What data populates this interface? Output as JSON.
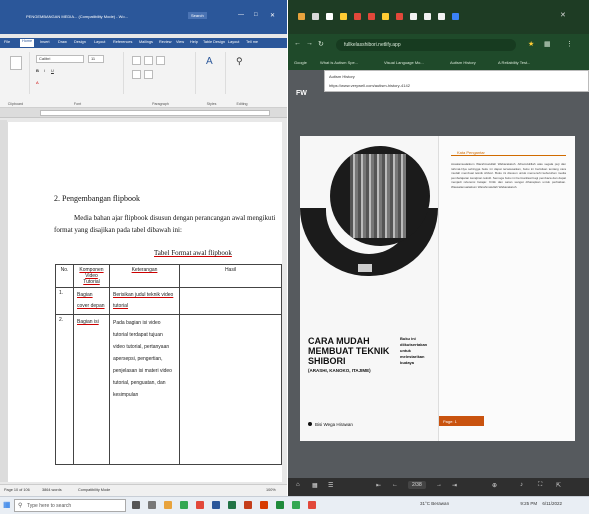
{
  "word": {
    "title": "PENGEMBANGAN MEDIA... (Compatibility Mode) - Wo...",
    "search_label": "Search",
    "menu_tabs": [
      "File",
      "Home",
      "Insert",
      "Draw",
      "Design",
      "Layout",
      "References",
      "Mailings",
      "Review",
      "View",
      "Help",
      "Table Design",
      "Layout",
      "Tell me"
    ],
    "ribbon_groups": [
      "Clipboard",
      "Font",
      "Paragraph",
      "Styles",
      "Editing"
    ],
    "font_name": "Calibri",
    "font_size": "11",
    "heading": "2. Pengembangan flipbook",
    "paragraph": "Media bahan ajar flipbook disusun dengan perancangan awal mengikuti format yang disajikan pada tabel dibawah ini:",
    "caption": "Tabel Format awal flipbook",
    "table": {
      "headers": [
        "No.",
        "Komponen Video Tutorial",
        "Keterangan",
        "Hasil"
      ],
      "rows": [
        {
          "no": "1.",
          "komponen": "Bagian cover depan",
          "keterangan": "Berisikan judul teknik video tutorial",
          "hasil": ""
        },
        {
          "no": "2.",
          "komponen": "Bagian isi",
          "keterangan": "Pada bagian isi video tutorial terdapat tujuan video tutorial, pertanyaan apersepsi, pengertian, penjelasan isi materi video tutorial, penguatan, dan kesimpulan",
          "hasil": ""
        }
      ]
    },
    "status": {
      "page": "Page 10 of 106",
      "words": "3864 words",
      "mode": "Compatibility Mode",
      "zoom": "100%"
    }
  },
  "browser": {
    "url": "fullkelasshibori.netlify.app",
    "bookmarks": [
      "Google",
      "What is Autism Spe...",
      "Visual Language Mo...",
      "Autism History",
      "A Reliability Test..."
    ],
    "history_title": "Autism History",
    "history_url": "https://www.verywell.com/autism-history-4142",
    "logo": "FW",
    "book": {
      "title": "CARA MUDAH MEMBUAT TEKNIK SHIBORI",
      "subtitle": "(ARASHI, KANOKO, ITAJIME)",
      "note": "Buku ini diikutsertakan untuk melestarikan budaya",
      "author": "Bisi Wega Hirawan",
      "kata_title": "Kata Pengantar",
      "kata_text": "Assalamualaikum Warahmatullah Wabarakatuh. Alhamdulillah atas segala puji dan rahmat-Nya sehingga buku ini dapat terselesaikan, buku ini berisikan tentang cara mudah membuat teknik shibori. Buku ini disusun untuk memenuhi kebutuhan media pembelajaran kerajinan tekstil. Semoga buku ini bermanfaat bagi pembaca dan dapat menjadi referensi belajar. Kritik dan saran sangat diharapkan untuk perbaikan. Wassalamualaikum Warahmatullah Wabarakatuh.",
      "page_label": "Page: 1"
    },
    "page_indicator": "2/38"
  },
  "taskbar": {
    "search_placeholder": "Type here to search",
    "weather": "31°C Berawan",
    "time": "9:25 PM",
    "date": "6/11/2022"
  },
  "colors": {
    "word_blue": "#2b579a",
    "browser_green": "#1f4a2a",
    "accent_orange": "#c9530f"
  }
}
